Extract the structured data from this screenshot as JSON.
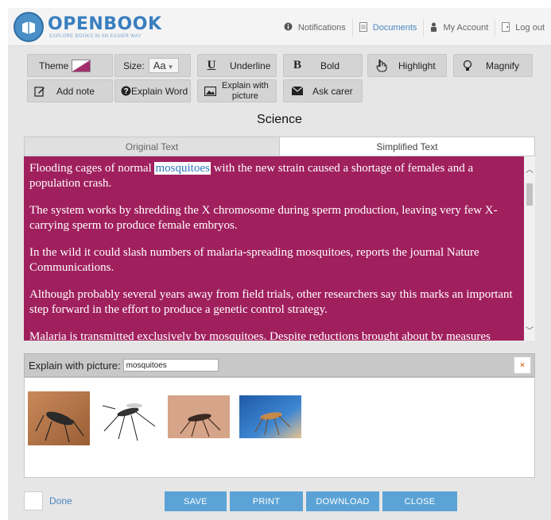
{
  "brand": {
    "name": "OPENBOOK",
    "tagline": "EXPLORE BOOKS IN AN EASIER WAY"
  },
  "nav": [
    {
      "label": "Notifications",
      "icon": "info-circle-icon"
    },
    {
      "label": "Documents",
      "icon": "document-icon"
    },
    {
      "label": "My Account",
      "icon": "user-icon"
    },
    {
      "label": "Log out",
      "icon": "logout-icon"
    }
  ],
  "toolbar": {
    "theme_label": "Theme",
    "size_label": "Size:",
    "size_value": "Aa",
    "underline_label": "Underline",
    "underline_glyph": "U",
    "bold_label": "Bold",
    "bold_glyph": "B",
    "highlight_label": "Highlight",
    "magnify_label": "Magnify",
    "add_note_label": "Add note",
    "explain_word_label": "Explain Word",
    "explain_picture_line1": "Explain with",
    "explain_picture_line2": "picture",
    "ask_carer_label": "Ask carer",
    "theme_colors": [
      "#ffffff",
      "#a12d6b"
    ]
  },
  "page_title": "Science",
  "tabs": [
    {
      "label": "Original Text",
      "active": false
    },
    {
      "label": "Simplified Text",
      "active": true
    }
  ],
  "text": {
    "highlighted_word": "mosquitoes",
    "p1_before": "Flooding cages of normal ",
    "p1_after": " with the new strain caused a shortage of females and a population crash.",
    "p2": "The system works by shredding the X chromosome during sperm production, leaving very few X-carrying sperm to produce female embryos.",
    "p3": "In the wild it could slash numbers of malaria-spreading mosquitoes, reports the journal Nature Communications.",
    "p4": "Although probably several years away from field trials, other researchers say this marks an important step forward in the effort to produce a genetic control strategy.",
    "p5": "Malaria is transmitted exclusively by mosquitoes.  Despite reductions brought about by measures",
    "panel_color": "#a0205e"
  },
  "explain_picture": {
    "label": "Explain with picture:",
    "query": "mosquitoes",
    "close_glyph": "×",
    "images": [
      "mosquito-photo-1",
      "mosquito-photo-2",
      "mosquito-photo-3",
      "mosquito-photo-4"
    ]
  },
  "footer": {
    "done_label": "Done",
    "save_label": "SAVE",
    "print_label": "PRINT",
    "download_label": "DOWNLOAD",
    "close_label": "CLOSE",
    "button_color": "#5ba3d6"
  }
}
